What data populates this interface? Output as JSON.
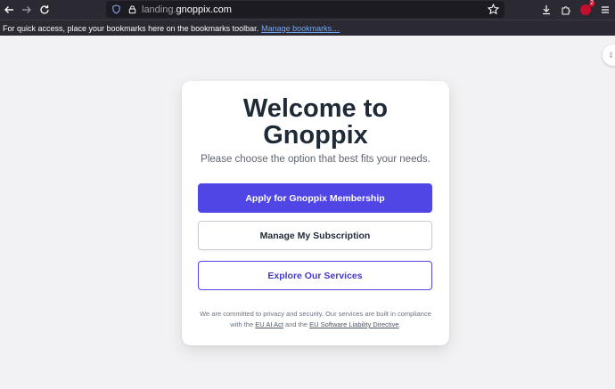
{
  "browser": {
    "url_prefix": "landing.",
    "url_domain": "gnoppix.com",
    "extension_count": "2"
  },
  "bookmarks_bar": {
    "message": "For quick access, place your bookmarks here on the bookmarks toolbar.",
    "link": "Manage bookmarks…"
  },
  "card": {
    "title_line1": "Welcome to",
    "title_line2": "Gnoppix",
    "subtitle": "Please choose the option that best fits your needs.",
    "buttons": {
      "apply": "Apply for Gnoppix Membership",
      "manage": "Manage My Subscription",
      "explore": "Explore Our Services"
    },
    "footnote": {
      "part1": "We are committed to privacy and security. Our services are built in compliance with the",
      "link1": "EU AI Act",
      "part2": "and the",
      "link2": "EU Software Liability Directive",
      "part3": "."
    }
  },
  "colors": {
    "primary": "#4f46e5",
    "title": "#1f2a37",
    "toolbar": "#2b2a33"
  }
}
